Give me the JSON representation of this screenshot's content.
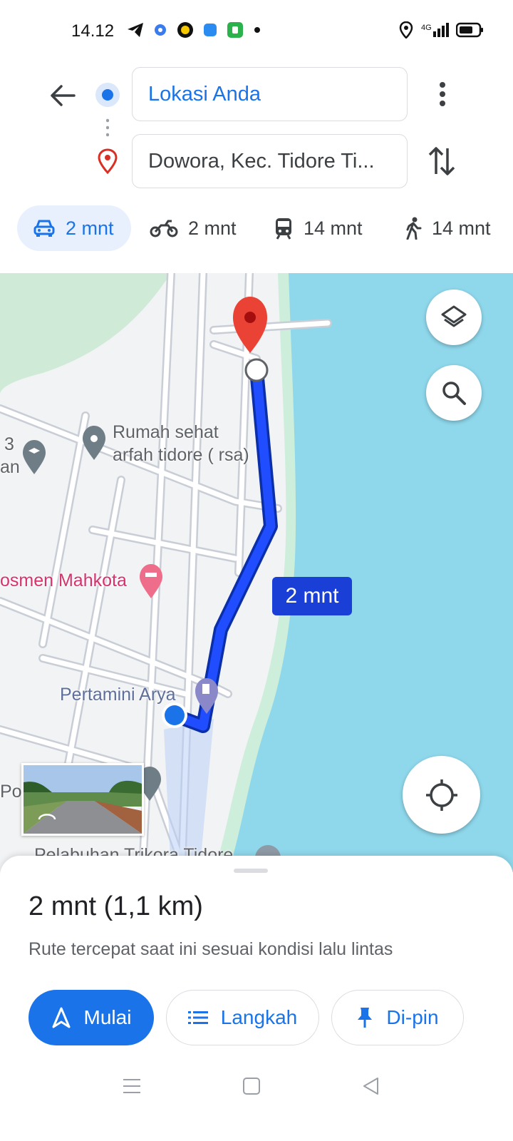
{
  "status_bar": {
    "time": "14.12",
    "network": "4G"
  },
  "directions": {
    "origin_value": "Lokasi Anda",
    "destination_value": "Dowora, Kec. Tidore Ti..."
  },
  "modes": [
    {
      "icon": "car-icon",
      "label": "2 mnt",
      "active": true
    },
    {
      "icon": "motorcycle-icon",
      "label": "2 mnt",
      "active": false
    },
    {
      "icon": "transit-icon",
      "label": "14 mnt",
      "active": false
    },
    {
      "icon": "walk-icon",
      "label": "14 mnt",
      "active": false
    }
  ],
  "map": {
    "labels": {
      "school_partial_1": "3",
      "school_partial_2": "an",
      "clinic_line1": "Rumah sehat",
      "clinic_line2": "arfah tidore ( rsa)",
      "hotel": "osmen Mahkota",
      "gas_station": "Pertamini Arya",
      "poi_partial": "Po",
      "harbor": "Pelabuhan Trikora Tidore"
    },
    "route_time_badge": "2 mnt",
    "colors": {
      "water": "#8fd8ec",
      "route": "#1a3fd6",
      "park": "#cde9d6"
    }
  },
  "sheet": {
    "summary": "2 mnt (1,1 km)",
    "subtitle": "Rute tercepat saat ini sesuai kondisi lalu lintas",
    "start_label": "Mulai",
    "steps_label": "Langkah",
    "pin_label": "Di-pin"
  }
}
